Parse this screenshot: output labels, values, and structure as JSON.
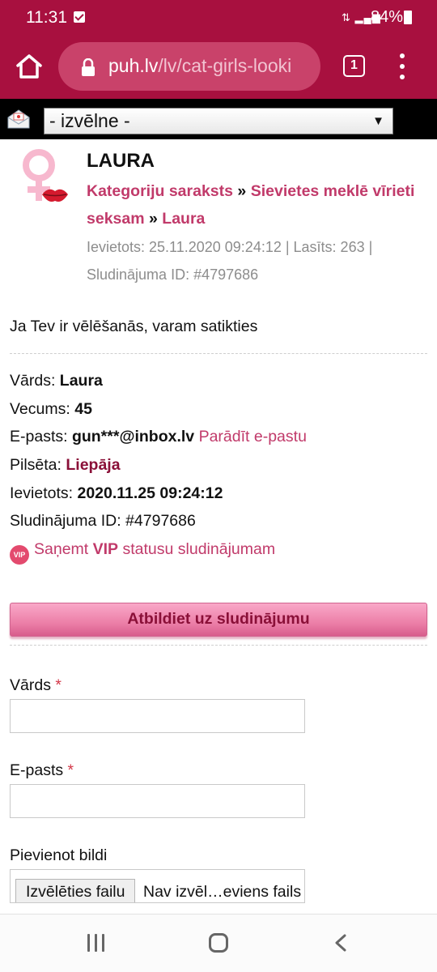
{
  "status_bar": {
    "time": "11:31",
    "battery": "84%",
    "icons": [
      "checkbox-notification-icon",
      "network-signal-icon",
      "battery-icon"
    ]
  },
  "browser": {
    "url_domain": "puh.lv",
    "url_path": "/lv/cat-girls-looki",
    "tab_count": "1",
    "icons": [
      "home-icon",
      "lock-icon",
      "tabs-icon",
      "more-menu-icon"
    ]
  },
  "site_nav": {
    "menu_select": "- izvēlne -"
  },
  "listing": {
    "title": "LAURA",
    "breadcrumb": {
      "category_list": "Kategoriju saraksts",
      "separator": "»",
      "category": "Sievietes meklē vīrieti seksam",
      "current": "Laura"
    },
    "meta_line1": "Ievietots: 25.11.2020 09:24:12 | Lasīts: 263 |",
    "meta_line2": "Sludinājuma ID: #4797686",
    "intro": "Ja Tev ir vēlēšanās, varam satikties",
    "details": {
      "name_label": "Vārds:",
      "name_value": "Laura",
      "age_label": "Vecums:",
      "age_value": "45",
      "email_label": "E-pasts:",
      "email_value": "gun***@inbox.lv",
      "show_email_link": "Parādīt e-pastu",
      "city_label": "Pilsēta:",
      "city_value": "Liepāja",
      "posted_label": "Ievietots:",
      "posted_value": "2020.11.25 09:24:12",
      "ad_id_label": "Sludinājuma ID:",
      "ad_id_value": "#4797686"
    },
    "vip": {
      "badge": "VIP",
      "text_before": "Saņemt",
      "text_bold": "VIP",
      "text_after": "statusu sludinājumam"
    }
  },
  "reply": {
    "header": "Atbildiet uz sludinājumu",
    "name_label": "Vārds",
    "email_label": "E-pasts",
    "required_mark": "*",
    "image_label": "Pievienot bildi",
    "file_button": "Izvēlēties failu",
    "file_status": "Nav izvēl…eviens fails"
  },
  "colors": {
    "brand": "#a8103f",
    "link": "#c13a6a",
    "city": "#8a1038",
    "meta": "#8d8d8d"
  }
}
